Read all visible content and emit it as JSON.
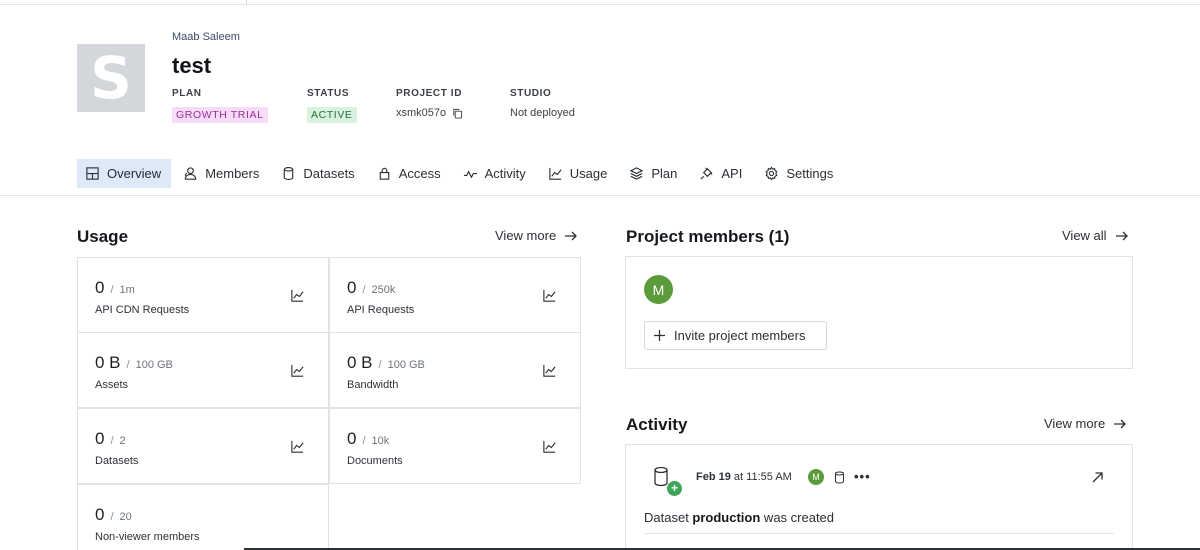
{
  "header": {
    "avatar_letter": "S",
    "owner": "Maab Saleem",
    "title": "test",
    "plan_label": "PLAN",
    "plan_value": "GROWTH TRIAL",
    "status_label": "STATUS",
    "status_value": "ACTIVE",
    "project_id_label": "PROJECT ID",
    "project_id_value": "xsmk057o",
    "studio_label": "STUDIO",
    "studio_value": "Not deployed"
  },
  "tabs": [
    {
      "label": "Overview",
      "icon": "grid-icon",
      "active": true
    },
    {
      "label": "Members",
      "icon": "members-icon",
      "active": false
    },
    {
      "label": "Datasets",
      "icon": "database-icon",
      "active": false
    },
    {
      "label": "Access",
      "icon": "lock-icon",
      "active": false
    },
    {
      "label": "Activity",
      "icon": "activity-icon",
      "active": false
    },
    {
      "label": "Usage",
      "icon": "line-chart-icon",
      "active": false
    },
    {
      "label": "Plan",
      "icon": "layers-icon",
      "active": false
    },
    {
      "label": "API",
      "icon": "plug-icon",
      "active": false
    },
    {
      "label": "Settings",
      "icon": "gear-icon",
      "active": false
    }
  ],
  "usage": {
    "title": "Usage",
    "view_more": "View more",
    "items": [
      {
        "value": "0",
        "limit": "1m",
        "label": "API CDN Requests"
      },
      {
        "value": "0",
        "limit": "250k",
        "label": "API Requests"
      },
      {
        "value": "0 B",
        "limit": "100 GB",
        "label": "Assets"
      },
      {
        "value": "0 B",
        "limit": "100 GB",
        "label": "Bandwidth"
      },
      {
        "value": "0",
        "limit": "2",
        "label": "Datasets"
      },
      {
        "value": "0",
        "limit": "10k",
        "label": "Documents"
      },
      {
        "value": "0",
        "limit": "20",
        "label": "Non-viewer members"
      }
    ],
    "separator": "/"
  },
  "members": {
    "title": "Project members (1)",
    "view_all": "View all",
    "avatar_initial": "M",
    "invite_label": "Invite project members"
  },
  "activity": {
    "title": "Activity",
    "view_more": "View more",
    "date": "Feb 19",
    "time_prefix": "at",
    "time": "11:55 AM",
    "avatar_initial": "M",
    "more": "•••",
    "text_before": "Dataset ",
    "text_bold": "production",
    "text_after": " was created"
  },
  "colors": {
    "tab_active_bg": "#dde9f7",
    "plan_badge_bg": "#f6dcf6",
    "plan_badge_text": "#9b2ca0",
    "status_badge_bg": "#d9f2df",
    "status_badge_text": "#21753b",
    "member_avatar": "#5c9b3a",
    "activity_plus": "#3fa55a"
  }
}
